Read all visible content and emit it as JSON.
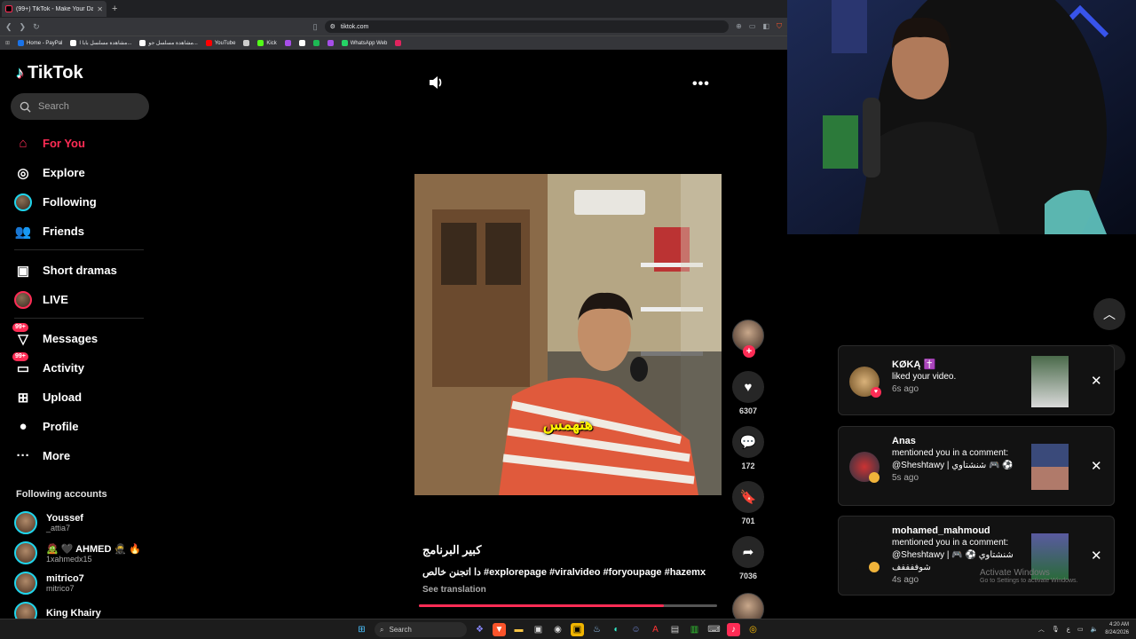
{
  "browser": {
    "tab_title": "(99+) TikTok - Make Your Day",
    "tab_close": "✕",
    "new_tab": "+",
    "url": "tiktok.com",
    "bookmarks": [
      {
        "label": "Home - PayPal",
        "color": "#1a73e8"
      },
      {
        "label": "مشاهدة مسلسل بابا ا...",
        "color": "#ffffff"
      },
      {
        "label": "مشاهدة مسلسل جو...",
        "color": "#ffffff"
      },
      {
        "label": "YouTube",
        "color": "#ff0000"
      },
      {
        "label": "",
        "color": "#cccccc"
      },
      {
        "label": "Kick",
        "color": "#53fc18"
      },
      {
        "label": "",
        "color": "#a64ee8"
      },
      {
        "label": "",
        "color": "#ffffff"
      },
      {
        "label": "",
        "color": "#1db954"
      },
      {
        "label": "",
        "color": "#a64ee8"
      },
      {
        "label": "WhatsApp Web",
        "color": "#25d366"
      },
      {
        "label": "",
        "color": "#e0245e"
      }
    ]
  },
  "sidebar": {
    "logo": "TikTok",
    "search_placeholder": "Search",
    "nav": [
      {
        "label": "For You",
        "icon": "home-icon",
        "glyph": "⌂",
        "active": true
      },
      {
        "label": "Explore",
        "icon": "compass-icon",
        "glyph": "◎"
      },
      {
        "label": "Following",
        "icon": "avatar",
        "glyph": ""
      },
      {
        "label": "Friends",
        "icon": "friends-icon",
        "glyph": "👥"
      },
      {
        "label": "Short dramas",
        "icon": "film-icon",
        "glyph": "▣"
      },
      {
        "label": "LIVE",
        "icon": "live-avatar",
        "glyph": ""
      },
      {
        "label": "Messages",
        "icon": "messages-icon",
        "glyph": "▽",
        "badge": "99+"
      },
      {
        "label": "Activity",
        "icon": "activity-icon",
        "glyph": "▭",
        "badge": "99+"
      },
      {
        "label": "Upload",
        "icon": "upload-icon",
        "glyph": "⊞"
      },
      {
        "label": "Profile",
        "icon": "profile-icon",
        "glyph": "●"
      },
      {
        "label": "More",
        "icon": "more-icon",
        "glyph": "···"
      }
    ],
    "following_title": "Following accounts",
    "following": [
      {
        "name": "Youssef",
        "handle": "_attia7"
      },
      {
        "name": "🧟 🖤 AHMED 🥷 🔥",
        "handle": "1xahmedx15"
      },
      {
        "name": "mitrico7",
        "handle": "mitrico7"
      },
      {
        "name": "King Khairy",
        "handle": ""
      }
    ]
  },
  "video": {
    "subtitle_overlay": "هتهمس",
    "author": "كبير البرنامج",
    "caption": "دا اتجنن خالص #explorepage #viralvideo #foryoupage #hazemx",
    "see_translation": "See translation",
    "progress": 0.82,
    "likes": "6307",
    "comments": "172",
    "saves": "701",
    "shares": "7036"
  },
  "notifications": [
    {
      "who": "KØKĄ ✝️",
      "text": "liked your video.",
      "time": "6s ago",
      "type": "like"
    },
    {
      "who": "Anas",
      "text": "mentioned you in a comment: @Sheshtawy | شنشتاوي 🎮 ⚽",
      "time": "5s ago",
      "type": "mention"
    },
    {
      "who": "mohamed_mahmoud",
      "text": "mentioned you in a comment: @Sheshtawy | شنشتاوي ⚽ 🎮 شوففففف",
      "time": "4s ago",
      "type": "mention"
    }
  ],
  "watermark": {
    "title": "Activate Windows",
    "sub": "Go to Settings to activate Windows."
  },
  "taskbar": {
    "search": "Search",
    "time": "4:20 AM",
    "date": "8/24/2026"
  },
  "colors": {
    "accent": "#fe2c55",
    "cyan": "#25f4ee",
    "bg": "#000000"
  }
}
